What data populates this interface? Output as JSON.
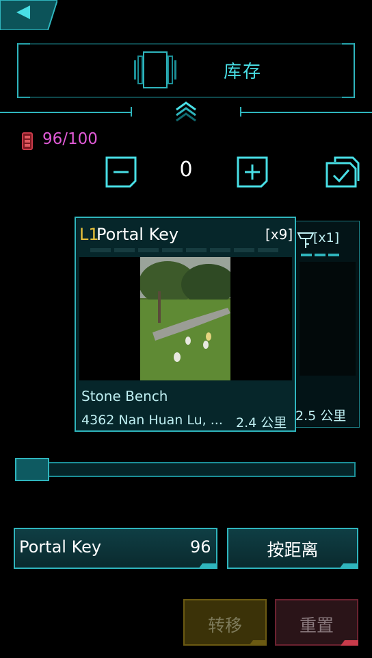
{
  "header": {
    "title": "库存"
  },
  "inventory": {
    "count": "96/100",
    "quantity": "0"
  },
  "back_card": {
    "multiplier": "[x1]",
    "distance": "2.5 公里"
  },
  "card": {
    "level": "L1",
    "name": "Portal Key",
    "multiplier": "[x9]",
    "portal_name": "Stone Bench",
    "address": "4362 Nan Huan Lu, ...",
    "distance": "2.4 公里"
  },
  "slider": {
    "value": 0
  },
  "filter": {
    "label": "Portal Key",
    "count": "96"
  },
  "sort": {
    "label": "按距离"
  },
  "actions": {
    "transfer": "转移",
    "reset": "重置"
  },
  "colors": {
    "accent": "#49dfe6",
    "count": "#e05ad6",
    "level": "#e8c13a",
    "transfer": "#3b3208",
    "reset": "#2a1418"
  },
  "icons": [
    "back-arrow-icon",
    "inventory-card-icon",
    "chevron-up-icon",
    "battery-icon",
    "minus-icon",
    "plus-icon",
    "check-folder-icon",
    "key-icon"
  ]
}
